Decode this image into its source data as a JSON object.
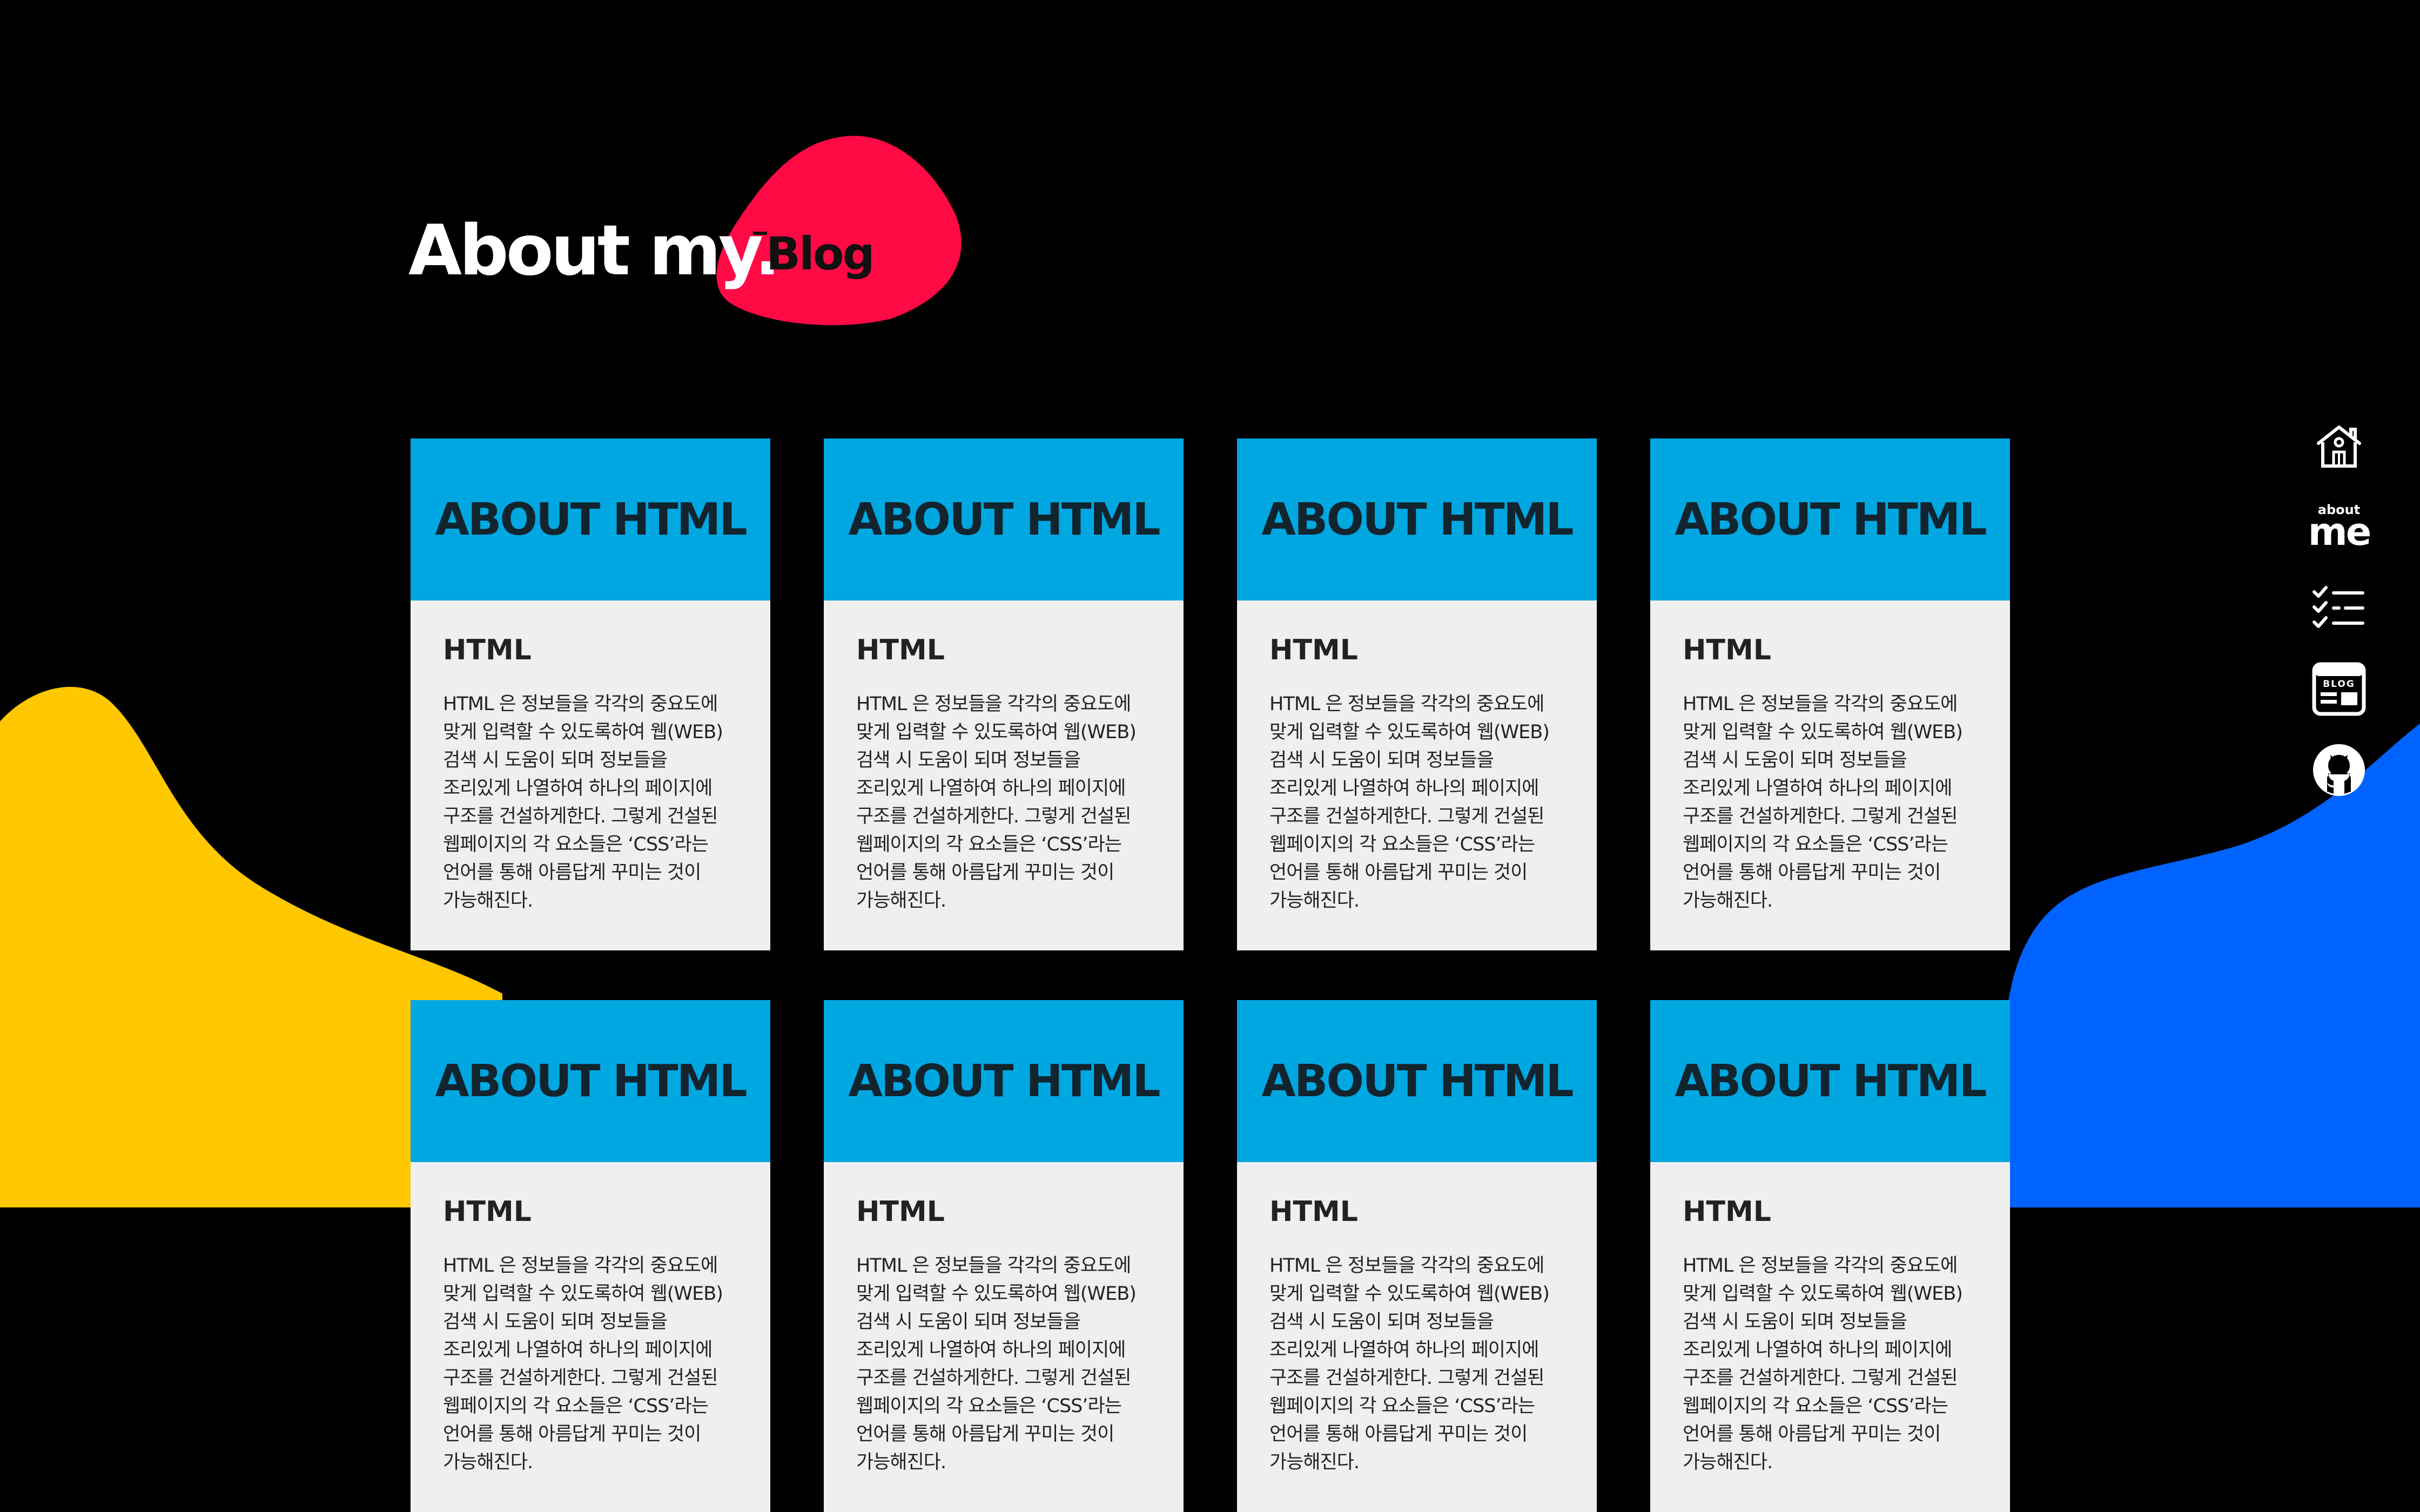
{
  "header": {
    "title_main": "About my.",
    "title_sub": "Blog"
  },
  "colors": {
    "background": "#000000",
    "card_header": "#00a7e1",
    "card_body": "#efefef",
    "blob_yellow": "#ffc800",
    "blob_blue": "#0062ff",
    "blob_red": "#ff0a45"
  },
  "cards": [
    {
      "heading": "ABOUT HTML",
      "subtitle": "HTML",
      "text": "HTML 은 정보들을 각각의 중요도에 맞게 입력할 수 있도록하여 웹(WEB) 검색 시 도움이 되며 정보들을 조리있게 나열하여 하나의 페이지에 구조를 건설하게한다. 그렇게 건설된 웹페이지의 각 요소들은 ‘CSS’라는 언어를 통해 아름답게 꾸미는 것이 가능해진다."
    },
    {
      "heading": "ABOUT HTML",
      "subtitle": "HTML",
      "text": "HTML 은 정보들을 각각의 중요도에 맞게 입력할 수 있도록하여 웹(WEB) 검색 시 도움이 되며 정보들을 조리있게 나열하여 하나의 페이지에 구조를 건설하게한다. 그렇게 건설된 웹페이지의 각 요소들은 ‘CSS’라는 언어를 통해 아름답게 꾸미는 것이 가능해진다."
    },
    {
      "heading": "ABOUT HTML",
      "subtitle": "HTML",
      "text": "HTML 은 정보들을 각각의 중요도에 맞게 입력할 수 있도록하여 웹(WEB) 검색 시 도움이 되며 정보들을 조리있게 나열하여 하나의 페이지에 구조를 건설하게한다. 그렇게 건설된 웹페이지의 각 요소들은 ‘CSS’라는 언어를 통해 아름답게 꾸미는 것이 가능해진다."
    },
    {
      "heading": "ABOUT HTML",
      "subtitle": "HTML",
      "text": "HTML 은 정보들을 각각의 중요도에 맞게 입력할 수 있도록하여 웹(WEB) 검색 시 도움이 되며 정보들을 조리있게 나열하여 하나의 페이지에 구조를 건설하게한다. 그렇게 건설된 웹페이지의 각 요소들은 ‘CSS’라는 언어를 통해 아름답게 꾸미는 것이 가능해진다."
    },
    {
      "heading": "ABOUT HTML",
      "subtitle": "HTML",
      "text": "HTML 은 정보들을 각각의 중요도에 맞게 입력할 수 있도록하여 웹(WEB) 검색 시 도움이 되며 정보들을 조리있게 나열하여 하나의 페이지에 구조를 건설하게한다. 그렇게 건설된 웹페이지의 각 요소들은 ‘CSS’라는 언어를 통해 아름답게 꾸미는 것이 가능해진다."
    },
    {
      "heading": "ABOUT HTML",
      "subtitle": "HTML",
      "text": "HTML 은 정보들을 각각의 중요도에 맞게 입력할 수 있도록하여 웹(WEB) 검색 시 도움이 되며 정보들을 조리있게 나열하여 하나의 페이지에 구조를 건설하게한다. 그렇게 건설된 웹페이지의 각 요소들은 ‘CSS’라는 언어를 통해 아름답게 꾸미는 것이 가능해진다."
    },
    {
      "heading": "ABOUT HTML",
      "subtitle": "HTML",
      "text": "HTML 은 정보들을 각각의 중요도에 맞게 입력할 수 있도록하여 웹(WEB) 검색 시 도움이 되며 정보들을 조리있게 나열하여 하나의 페이지에 구조를 건설하게한다. 그렇게 건설된 웹페이지의 각 요소들은 ‘CSS’라는 언어를 통해 아름답게 꾸미는 것이 가능해진다."
    },
    {
      "heading": "ABOUT HTML",
      "subtitle": "HTML",
      "text": "HTML 은 정보들을 각각의 중요도에 맞게 입력할 수 있도록하여 웹(WEB) 검색 시 도움이 되며 정보들을 조리있게 나열하여 하나의 페이지에 구조를 건설하게한다. 그렇게 건설된 웹페이지의 각 요소들은 ‘CSS’라는 언어를 통해 아름답게 꾸미는 것이 가능해진다."
    }
  ],
  "sidenav": {
    "home": {
      "icon": "home-icon"
    },
    "about": {
      "icon": "about-me-icon",
      "top_text": "about",
      "main_text": "me"
    },
    "todo": {
      "icon": "checklist-icon"
    },
    "blog": {
      "icon": "blog-icon",
      "label": "BLOG"
    },
    "github": {
      "icon": "github-icon"
    }
  }
}
